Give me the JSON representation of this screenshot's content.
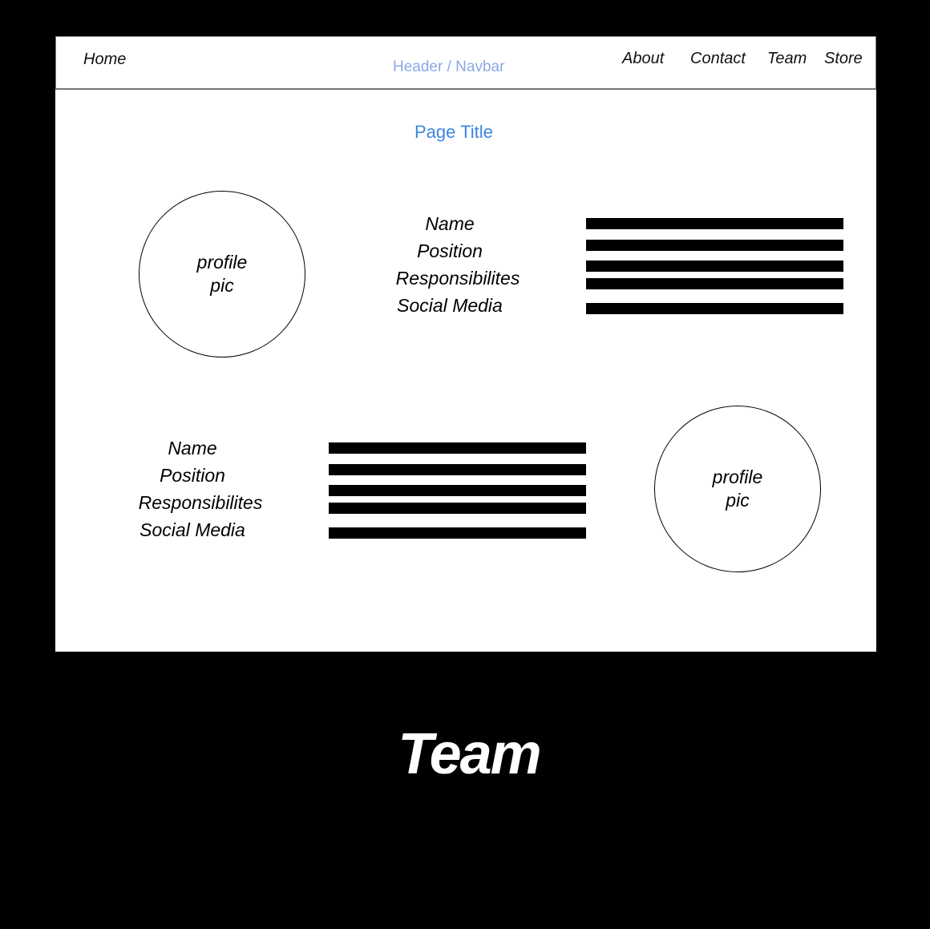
{
  "navbar": {
    "home": "Home",
    "label": "Header / Navbar",
    "about": "About",
    "contact": "Contact",
    "team": "Team",
    "store": "Store"
  },
  "page_title": "Page Title",
  "members": [
    {
      "pic_line1": "profile",
      "pic_line2": "pic",
      "name": "Name",
      "position": "Position",
      "responsibilities": "Responsibilites",
      "social": "Social Media"
    },
    {
      "pic_line1": "profile",
      "pic_line2": "pic",
      "name": "Name",
      "position": "Position",
      "responsibilities": "Responsibilites",
      "social": "Social Media"
    }
  ],
  "caption": "Team",
  "colors": {
    "background": "#000000",
    "frame": "#ffffff",
    "navbar_label": "#8aaae6",
    "page_title": "#3d86e0"
  }
}
